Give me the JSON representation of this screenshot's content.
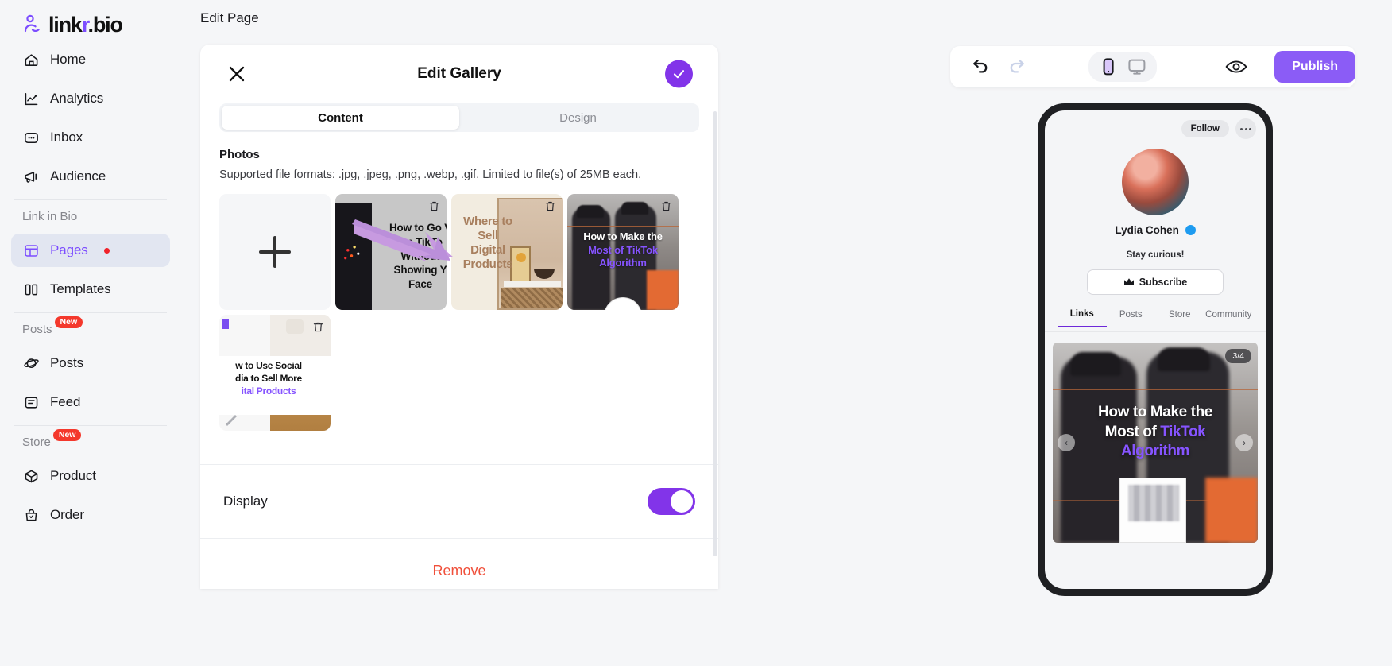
{
  "brand": {
    "name_prefix": "link",
    "name_accent": "r",
    "name_suffix": ".bio",
    "accent_color": "#7c4dff"
  },
  "sidebar": {
    "items": [
      {
        "label": "Home",
        "icon": "home-icon"
      },
      {
        "label": "Analytics",
        "icon": "chart-line-icon"
      },
      {
        "label": "Inbox",
        "icon": "inbox-chat-icon"
      },
      {
        "label": "Audience",
        "icon": "megaphone-icon"
      }
    ],
    "groups": [
      {
        "title": "Link in Bio",
        "badge": "",
        "items": [
          {
            "label": "Pages",
            "icon": "layout-icon",
            "active": true,
            "dot": true
          },
          {
            "label": "Templates",
            "icon": "columns-icon",
            "active": false,
            "dot": false
          }
        ]
      },
      {
        "title": "Posts",
        "badge": "New",
        "items": [
          {
            "label": "Posts",
            "icon": "planet-icon",
            "active": false,
            "dot": false
          },
          {
            "label": "Feed",
            "icon": "feed-icon",
            "active": false,
            "dot": false
          }
        ]
      },
      {
        "title": "Store",
        "badge": "New",
        "items": [
          {
            "label": "Product",
            "icon": "box-icon",
            "active": false,
            "dot": false
          },
          {
            "label": "Order",
            "icon": "bag-icon",
            "active": false,
            "dot": false
          }
        ]
      }
    ]
  },
  "header": {
    "page_title": "Edit Page"
  },
  "modal": {
    "title": "Edit Gallery",
    "close_icon": "close-icon",
    "confirm_icon": "check-icon",
    "tabs": [
      {
        "label": "Content",
        "active": true
      },
      {
        "label": "Design",
        "active": false
      }
    ],
    "photos_section": {
      "label": "Photos",
      "note": "Supported file formats: .jpg, .jpeg, .png, .webp, .gif. Limited to file(s) of 25MB each.",
      "add_button_icon": "plus-icon",
      "items": [
        {
          "caption_lines": [
            "How to Go V",
            "On TikTo",
            "Without",
            "Showing Y",
            "Face"
          ],
          "delete_icon": "trash-icon"
        },
        {
          "caption_lines": [
            "Where to",
            "Sell",
            "Digital",
            "Products"
          ],
          "delete_icon": "trash-icon"
        },
        {
          "caption_lines": [
            "How to Make the",
            "Most of TikTok",
            "Algorithm"
          ],
          "delete_icon": "trash-icon"
        },
        {
          "caption_lines": [
            "w to Use Social",
            "dia to Sell More",
            "ital Products"
          ],
          "delete_icon": "trash-icon"
        }
      ]
    },
    "display": {
      "label": "Display",
      "enabled": true
    },
    "remove": {
      "label": "Remove",
      "color": "#f0503b"
    }
  },
  "preview_toolbar": {
    "undo_icon": "undo-icon",
    "redo_icon": "redo-icon",
    "device_mobile_icon": "mobile-icon",
    "device_desktop_icon": "desktop-icon",
    "preview_icon": "eye-icon",
    "publish_label": "Publish",
    "publish_color": "#8b5cf6"
  },
  "phone_preview": {
    "follow_label": "Follow",
    "more_icon": "more-dots-icon",
    "avatar": "profile-avatar",
    "username": "Lydia Cohen",
    "verified_icon": "verified-badge-icon",
    "bio": "Stay curious!",
    "subscribe_label": "Subscribe",
    "subscribe_icon": "crown-icon",
    "tabs": [
      {
        "label": "Links",
        "active": true
      },
      {
        "label": "Posts",
        "active": false
      },
      {
        "label": "Store",
        "active": false
      },
      {
        "label": "Community",
        "active": false
      }
    ],
    "gallery": {
      "counter": "3/4",
      "caption_line1": "How to Make the",
      "caption_line2_plain": "Most of ",
      "caption_line2_accent": "TikTok",
      "caption_line3": "Algorithm",
      "prev_icon": "chevron-left-icon",
      "next_icon": "chevron-right-icon"
    }
  }
}
